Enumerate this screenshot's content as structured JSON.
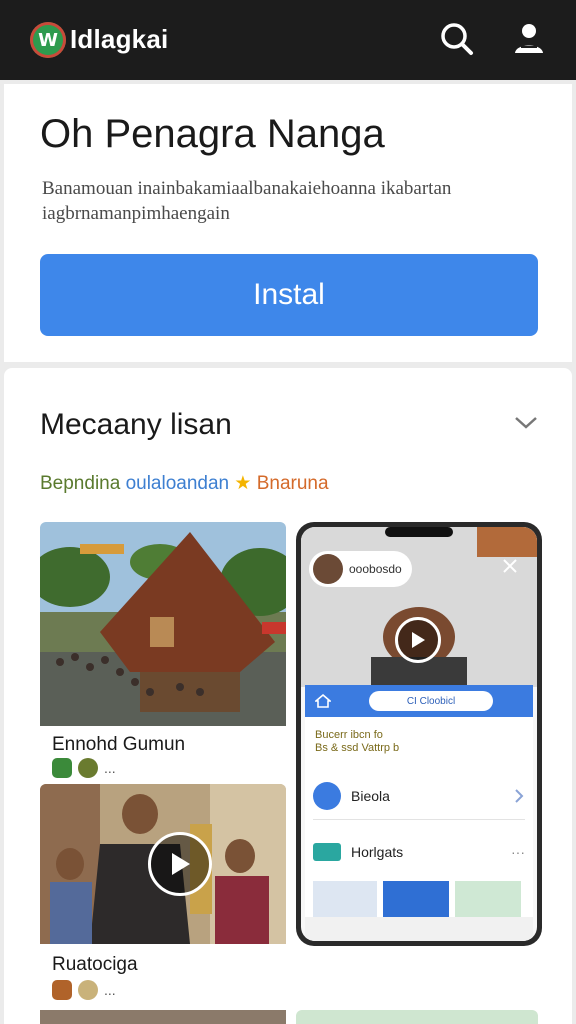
{
  "topbar": {
    "logo_letter": "W",
    "app_name": "Idlagkai",
    "icons": [
      "search-icon",
      "user-icon"
    ]
  },
  "app_card": {
    "title": "Oh Penagra Nanga",
    "description": "Banamouan inainbakamiaalbanakaiehoanna ikabartan iagbrnamanpimhaengain",
    "install_label": "Instal"
  },
  "media_section": {
    "title": "Mecaany lisan",
    "tagline_part1": "Bepndina",
    "tagline_part2": "oulaloandan",
    "tagline_star": "★",
    "tagline_part3": "Bnaruna",
    "tiles": [
      {
        "label": "Ennohd Gumun",
        "meta": "..."
      },
      {
        "label": "Ruatociga",
        "meta": "..."
      }
    ],
    "phone": {
      "bubble_text": "ooobosdo",
      "chip_text": "CI Cloobicl",
      "note_line1": "Bucerr ibcn fo",
      "note_line2": "Bs & ssd Vattrp b",
      "row1_label": "Bieola",
      "row2_label": "Horlgats"
    }
  },
  "colors": {
    "topbar": "#1c1c1c",
    "install_button": "#3e87ea",
    "logo_green": "#2e9b4e"
  }
}
